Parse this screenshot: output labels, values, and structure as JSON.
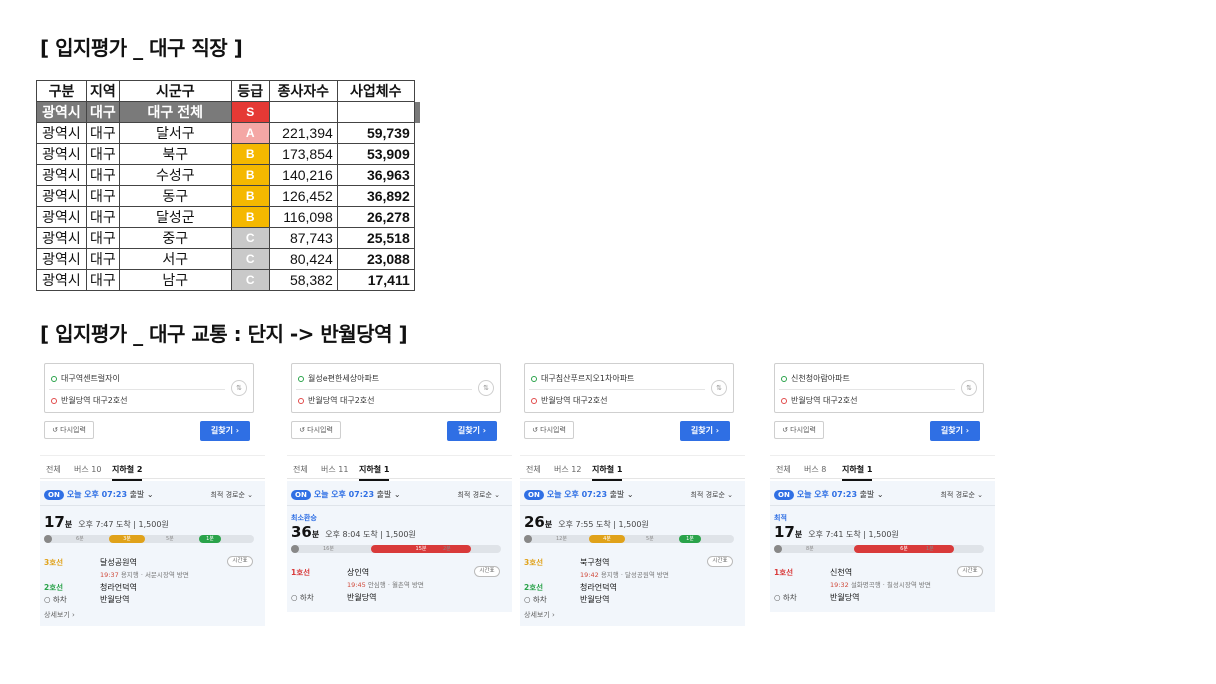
{
  "headings": {
    "workplace": "[ 입지평가 _ 대구 직장 ]",
    "transit": "[ 입지평가 _ 대구 교통 : 단지 -> 반월당역 ]"
  },
  "table": {
    "headers": [
      "구분",
      "지역",
      "시군구",
      "등급",
      "종사자수",
      "사업체수"
    ],
    "total": {
      "type": "광역시",
      "region": "대구",
      "district": "대구 전체",
      "grade": "S"
    },
    "rows": [
      {
        "type": "광역시",
        "region": "대구",
        "district": "달서구",
        "grade": "A",
        "workers": "221,394",
        "businesses": "59,739"
      },
      {
        "type": "광역시",
        "region": "대구",
        "district": "북구",
        "grade": "B",
        "workers": "173,854",
        "businesses": "53,909"
      },
      {
        "type": "광역시",
        "region": "대구",
        "district": "수성구",
        "grade": "B",
        "workers": "140,216",
        "businesses": "36,963"
      },
      {
        "type": "광역시",
        "region": "대구",
        "district": "동구",
        "grade": "B",
        "workers": "126,452",
        "businesses": "36,892"
      },
      {
        "type": "광역시",
        "region": "대구",
        "district": "달성군",
        "grade": "B",
        "workers": "116,098",
        "businesses": "26,278"
      },
      {
        "type": "광역시",
        "region": "대구",
        "district": "중구",
        "grade": "C",
        "workers": "87,743",
        "businesses": "25,518"
      },
      {
        "type": "광역시",
        "region": "대구",
        "district": "서구",
        "grade": "C",
        "workers": "80,424",
        "businesses": "23,088"
      },
      {
        "type": "광역시",
        "region": "대구",
        "district": "남구",
        "grade": "C",
        "workers": "58,382",
        "businesses": "17,411"
      }
    ],
    "grade_colors": {
      "S": "#e53935",
      "A": "#f4a7a5",
      "B": "#f5b800",
      "C": "#c9c9c9"
    }
  },
  "common": {
    "reset": "↺ 다시입력",
    "find": "길찾기 ›",
    "all_tab": "전체",
    "on": "ON",
    "today": "오늘",
    "depart_time": "오후 07:23",
    "depart_suffix": "출발 ⌄",
    "sort": "최적 경로순 ⌄",
    "min_unit": "분",
    "fare": "1,500원",
    "timetable": "시간표",
    "alight": "○ 하차",
    "more": "상세보기 ›",
    "swap": "⇅"
  },
  "cards": [
    {
      "origin": "대구역센트럴자이",
      "destination": "반월당역 대구2호선",
      "bus_tab": "버스 10",
      "subway_tab": "지하철 2",
      "badge": "",
      "minutes": "17",
      "arrive": "오후 7:47 도착",
      "legs": [
        {
          "line": "3호선",
          "color": "#e0a21a",
          "station": "달성공원역",
          "time": "19:37",
          "sub": "용지행 · 서문시장역 방면",
          "timetable": true
        },
        {
          "line": "2호선",
          "color": "#2aa34a",
          "station": "청라언덕역",
          "time": "",
          "sub": "",
          "timetable": false
        }
      ],
      "final": "반월당역",
      "show_more": true,
      "bar": {
        "labels": [
          "6분",
          "3분",
          "5분",
          "1분"
        ]
      }
    },
    {
      "origin": "월성e편한세상아파트",
      "destination": "반월당역 대구2호선",
      "bus_tab": "버스 11",
      "subway_tab": "지하철 1",
      "badge": "최소환승",
      "minutes": "36",
      "arrive": "오후 8:04 도착",
      "legs": [
        {
          "line": "1호선",
          "color": "#d93a3a",
          "station": "상인역",
          "time": "19:45",
          "sub": "안심행 · 월촌역 방면",
          "timetable": true
        }
      ],
      "final": "반월당역",
      "show_more": false,
      "bar": {
        "labels": [
          "16분",
          "15분",
          "2분"
        ]
      }
    },
    {
      "origin": "대구침산푸르지오1차아파트",
      "destination": "반월당역 대구2호선",
      "bus_tab": "버스 12",
      "subway_tab": "지하철 1",
      "badge": "",
      "minutes": "26",
      "arrive": "오후 7:55 도착",
      "legs": [
        {
          "line": "3호선",
          "color": "#e0a21a",
          "station": "북구청역",
          "time": "19:42",
          "sub": "용지행 · 달성공원역 방면",
          "timetable": true
        },
        {
          "line": "2호선",
          "color": "#2aa34a",
          "station": "청라언덕역",
          "time": "",
          "sub": "",
          "timetable": false
        }
      ],
      "final": "반월당역",
      "show_more": true,
      "bar": {
        "labels": [
          "12분",
          "4분",
          "5분",
          "1분"
        ]
      }
    },
    {
      "origin": "신천청아람아파트",
      "destination": "반월당역 대구2호선",
      "bus_tab": "버스 8",
      "subway_tab": "지하철 1",
      "badge": "최적",
      "minutes": "17",
      "arrive": "오후 7:41 도착",
      "legs": [
        {
          "line": "1호선",
          "color": "#d93a3a",
          "station": "신천역",
          "time": "19:32",
          "sub": "설화명곡행 · 칠성시장역 방면",
          "timetable": true
        }
      ],
      "final": "반월당역",
      "show_more": false,
      "bar": {
        "labels": [
          "8분",
          "6분",
          "1분"
        ]
      }
    }
  ]
}
